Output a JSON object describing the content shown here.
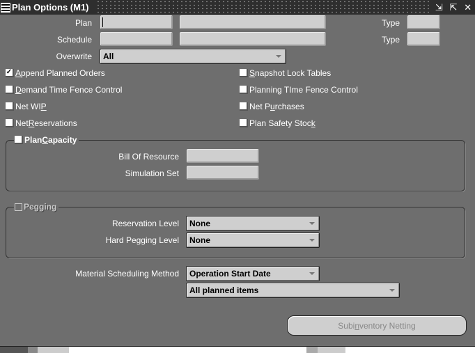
{
  "window": {
    "title": "Plan Options (M1)",
    "controls": {
      "minimize": "⇲",
      "maximize": "⇱",
      "close": "✕"
    }
  },
  "header_fields": {
    "plan_label": "Plan",
    "plan_value": "",
    "plan_desc": "",
    "plan_type_label": "Type",
    "plan_type_value": "",
    "schedule_label": "Schedule",
    "schedule_value": "",
    "schedule_desc": "",
    "schedule_type_label": "Type",
    "schedule_type_value": "",
    "overwrite_label": "Overwrite",
    "overwrite_value": "All"
  },
  "options": {
    "left": [
      {
        "pre": "",
        "u": "A",
        "post": "ppend Planned Orders",
        "checked": true
      },
      {
        "pre": "",
        "u": "D",
        "post": "emand Time Fence Control",
        "checked": false
      },
      {
        "pre": "Net WI",
        "u": "P",
        "post": "",
        "checked": false
      },
      {
        "pre": "Net ",
        "u": "R",
        "post": "eservations",
        "checked": false
      }
    ],
    "right": [
      {
        "pre": "",
        "u": "S",
        "post": "napshot Lock Tables",
        "checked": false
      },
      {
        "pre": "Planning TIme Fence Control",
        "u": "",
        "post": "",
        "checked": false
      },
      {
        "pre": "Net P",
        "u": "u",
        "post": "rchases",
        "checked": false
      },
      {
        "pre": "Plan Safety Stoc",
        "u": "k",
        "post": "",
        "checked": false
      }
    ]
  },
  "plan_capacity": {
    "title_pre": "Plan ",
    "title_u": "C",
    "title_post": "apacity",
    "checked": false,
    "bill_of_resource_label": "Bill Of Resource",
    "bill_of_resource_value": "",
    "simulation_set_label": "Simulation Set",
    "simulation_set_value": ""
  },
  "pegging": {
    "title": "Pegging",
    "checked": false,
    "enabled": false,
    "reservation_level_label": "Reservation Level",
    "reservation_level_value": "None",
    "hard_pegging_level_label": "Hard Pegging Level",
    "hard_pegging_level_value": "None"
  },
  "scheduling": {
    "material_scheduling_method_label": "Material Scheduling Method",
    "material_scheduling_method_value": "Operation Start Date",
    "items_value": "All planned items"
  },
  "buttons": {
    "subinventory_netting_pre": "Subi",
    "subinventory_netting_u": "n",
    "subinventory_netting_post": "ventory Netting"
  }
}
